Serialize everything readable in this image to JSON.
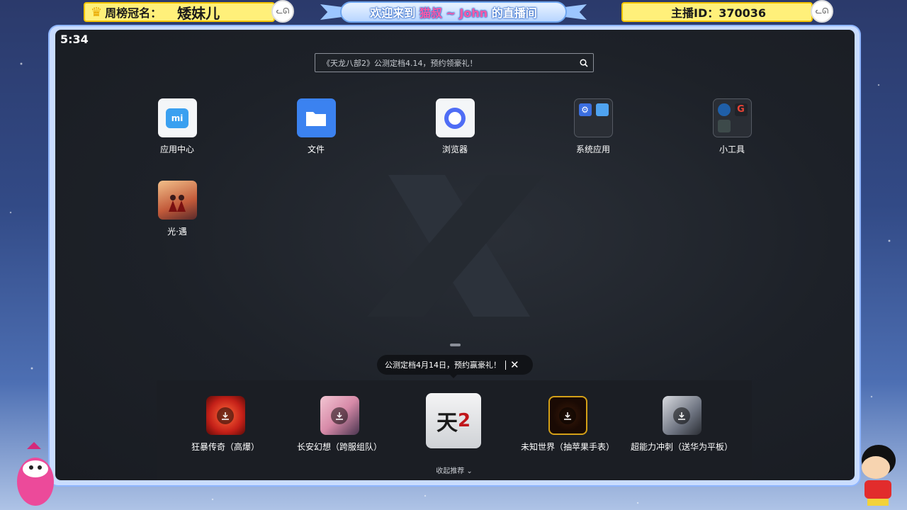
{
  "overlay": {
    "crown_label": "周榜冠名：",
    "crown_name": "矮妹儿",
    "welcome_pre": "欢迎来到",
    "welcome_name": "猫叔 ~ John",
    "welcome_post": "的直播间",
    "host_id": "主播ID：370036"
  },
  "status": {
    "time": "5:34"
  },
  "search": {
    "placeholder": "《天龙八部2》公测定档4.14，预约领豪礼！",
    "icon": "search-icon"
  },
  "apps": [
    {
      "label": "应用中心",
      "icon": "mi-store-icon",
      "color": "#3aa0f0"
    },
    {
      "label": "文件",
      "icon": "folder-icon",
      "color": "#3b82f0"
    },
    {
      "label": "浏览器",
      "icon": "browser-icon",
      "color": "#4f6df5"
    },
    {
      "label": "系统应用",
      "icon": "folder-system-apps-icon"
    },
    {
      "label": "小工具",
      "icon": "folder-tools-icon"
    },
    {
      "label": "光·遇",
      "icon": "sky-game-icon"
    }
  ],
  "tooltip": {
    "text": "公测定档4月14日，预约赢豪礼！",
    "close": "✕"
  },
  "dock": {
    "games": [
      {
        "label": "狂暴传奇（高爆）",
        "icon": "kuangbao-chuanqi-icon",
        "color": "#c42018"
      },
      {
        "label": "长安幻想（跨服组队）",
        "icon": "changan-huanxiang-icon",
        "color": "#d78aa8"
      },
      {
        "label": "",
        "icon": "tianlong-babu-2-icon",
        "color": "#e9eaec"
      },
      {
        "label": "未知世界（抽苹果手表）",
        "icon": "weizhi-shijie-icon",
        "color": "#b8860b"
      },
      {
        "label": "超能力冲刺（送华为平板）",
        "icon": "chaonengli-chongci-icon",
        "color": "#6d7380"
      }
    ],
    "collapse_label": "收起推荐"
  }
}
